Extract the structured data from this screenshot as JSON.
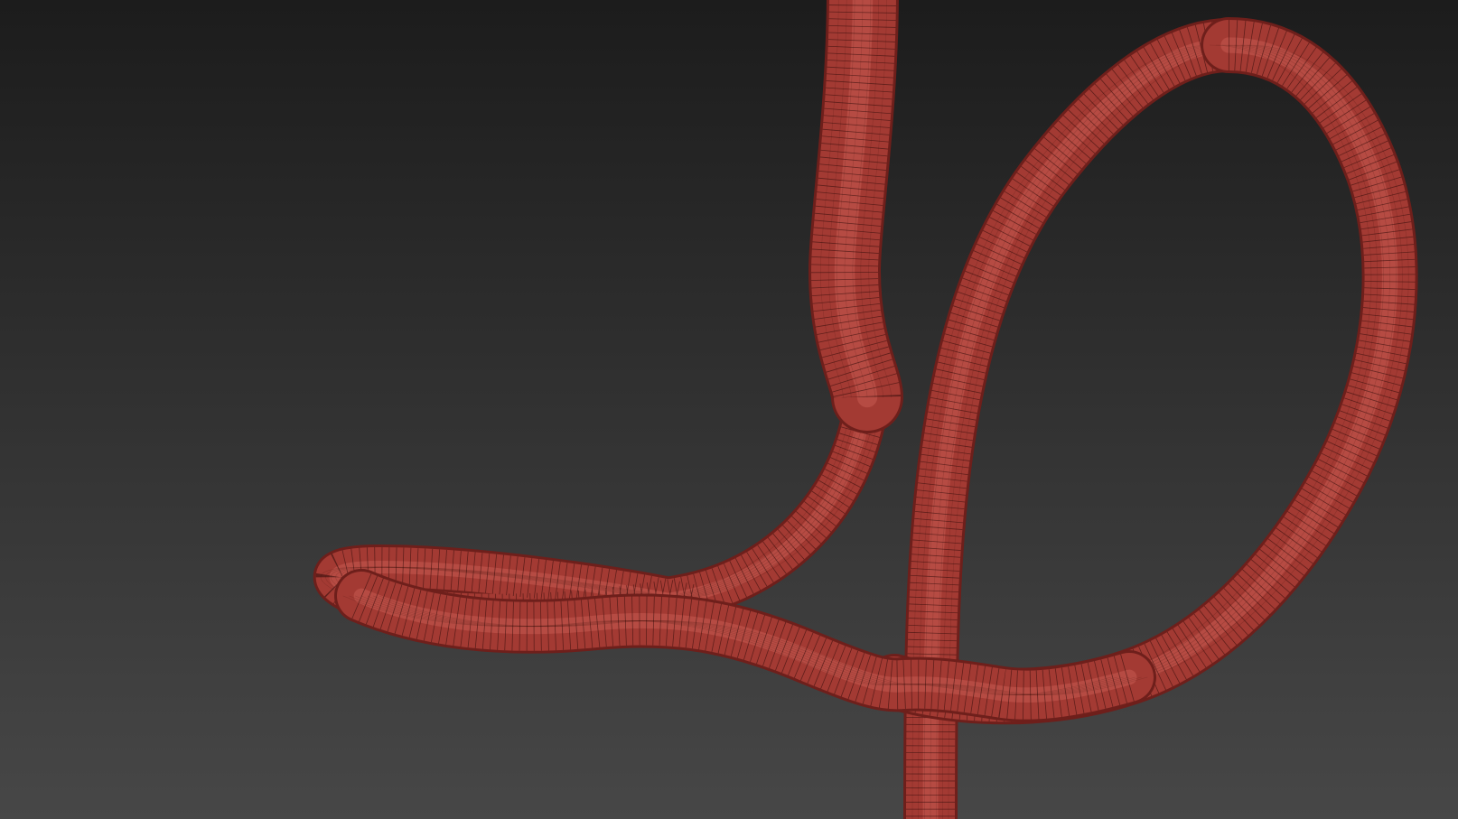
{
  "viewport": {
    "background_top_color": "#1c1c1c",
    "background_bottom_color": "#474747",
    "object": {
      "name": "tube-mesh",
      "base_color": "#a33a33",
      "highlight_color": "#c65a50",
      "shadow_color": "#6e1f1b",
      "wire_color": "#2a0a08",
      "wireframe": true
    }
  }
}
